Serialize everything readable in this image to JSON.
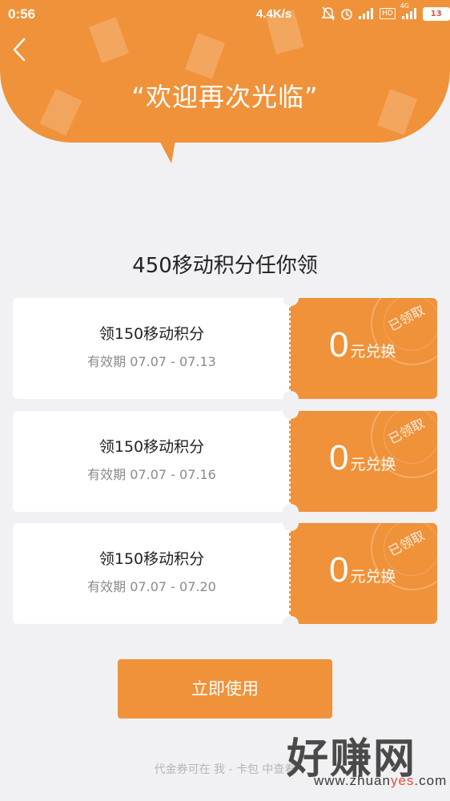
{
  "status_bar": {
    "time": "0:56",
    "network_speed": "4.4K/s",
    "network_type": "4G",
    "hd_label": "HD",
    "battery_level": "13",
    "icons": [
      "mute-icon",
      "alarm-icon",
      "signal-icon",
      "hd-icon",
      "signal-4g-icon",
      "battery-icon"
    ]
  },
  "header": {
    "welcome_text": "“欢迎再次光临”",
    "back_icon": "chevron-left-icon",
    "background_color": "#f0923a"
  },
  "section_title": "450移动积分任你领",
  "coupons": [
    {
      "title": "领150移动积分",
      "validity": "有效期 07.07 - 07.13",
      "amount": "0",
      "unit": "元兑换",
      "status": "已领取"
    },
    {
      "title": "领150移动积分",
      "validity": "有效期 07.07 - 07.16",
      "amount": "0",
      "unit": "元兑换",
      "status": "已领取"
    },
    {
      "title": "领150移动积分",
      "validity": "有效期 07.07 - 07.20",
      "amount": "0",
      "unit": "元兑换",
      "status": "已领取"
    }
  ],
  "use_button_label": "立即使用",
  "footer_text": "代金券可在 我 - 卡包 中查看",
  "watermark": {
    "big": "好赚网",
    "small_prefix": "www.zhuan",
    "small_highlight": "yes",
    "small_suffix": ".com"
  },
  "colors": {
    "accent": "#f0923a",
    "page_background": "#f1f1f4",
    "card_background": "#ffffff"
  }
}
